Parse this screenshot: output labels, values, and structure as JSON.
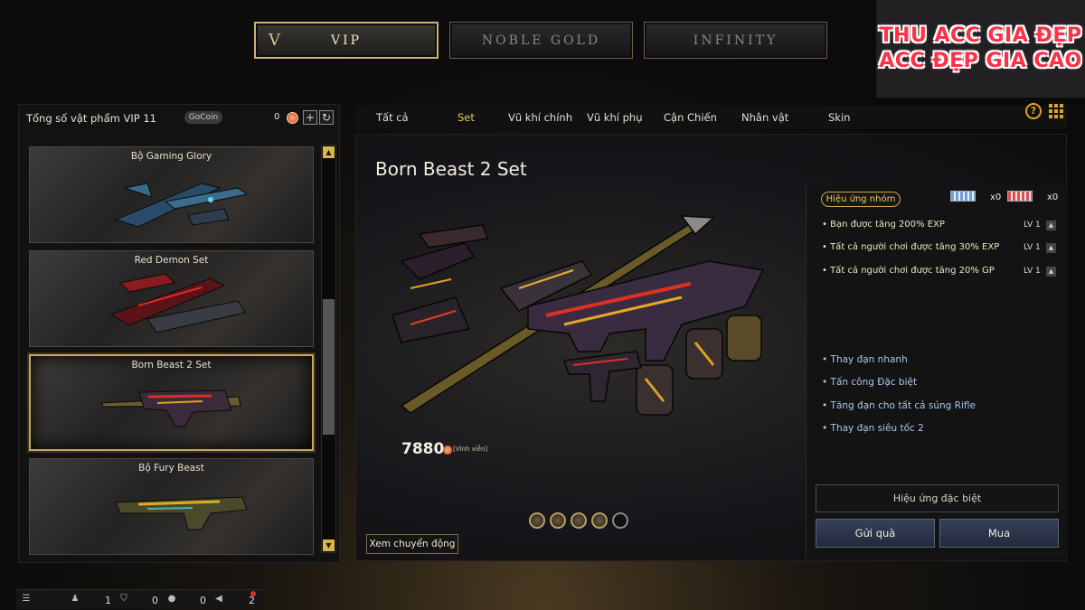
{
  "top_tabs": [
    {
      "label": "VIP",
      "roman": "V",
      "active": true
    },
    {
      "label": "NOBLE GOLD",
      "active": false
    },
    {
      "label": "INFINITY",
      "active": false
    }
  ],
  "watermark": {
    "line1": "THU ACC GIA ĐẸP",
    "line2": "ACC ĐẸP GIA CAO"
  },
  "left": {
    "total_label": "Tổng số vật phẩm VIP 11",
    "gocoin_label": "GoCoin",
    "coin_count": "0",
    "plus": "+",
    "refresh": "↻",
    "items": [
      {
        "name": "Bộ Gaming Glory"
      },
      {
        "name": "Red Demon Set"
      },
      {
        "name": "Born Beast 2 Set"
      },
      {
        "name": "Bộ Fury Beast"
      }
    ],
    "scroll_up": "▲",
    "scroll_down": "▼"
  },
  "categories": [
    "Tất cả",
    "Set",
    "Vũ khí chính",
    "Vũ khí phụ",
    "Cận Chiến",
    "Nhân vật",
    "Skin"
  ],
  "active_category": "Set",
  "help": "?",
  "main": {
    "title": "Born Beast 2 Set",
    "price": "7880",
    "price_note": "[Vĩnh viễn]",
    "motion_button": "Xem chuyển động"
  },
  "effects": {
    "group_label": "Hiệu ứng nhóm",
    "card1_count": "x0",
    "card2_count": "x0",
    "bonuses": [
      {
        "text": "• Bạn được tăng 200%  EXP",
        "lv": "LV 1"
      },
      {
        "text": "• Tất cả người chơi được tăng 30% EXP",
        "lv": "LV 1"
      },
      {
        "text": "• Tất cả người chơi được tăng 20% GP",
        "lv": "LV 1"
      }
    ],
    "abilities": [
      "• Thay đạn nhanh",
      "• Tấn công Đặc biệt",
      "• Tăng đạn cho tất cả súng Rifle",
      "• Thay đạn siêu tốc 2"
    ],
    "special_button": "Hiệu ứng đặc biệt",
    "gift_button": "Gửi quà",
    "buy_button": "Mua"
  },
  "status_bar": {
    "count1": "1",
    "count2": "0",
    "count3": "0",
    "count4": "2"
  }
}
